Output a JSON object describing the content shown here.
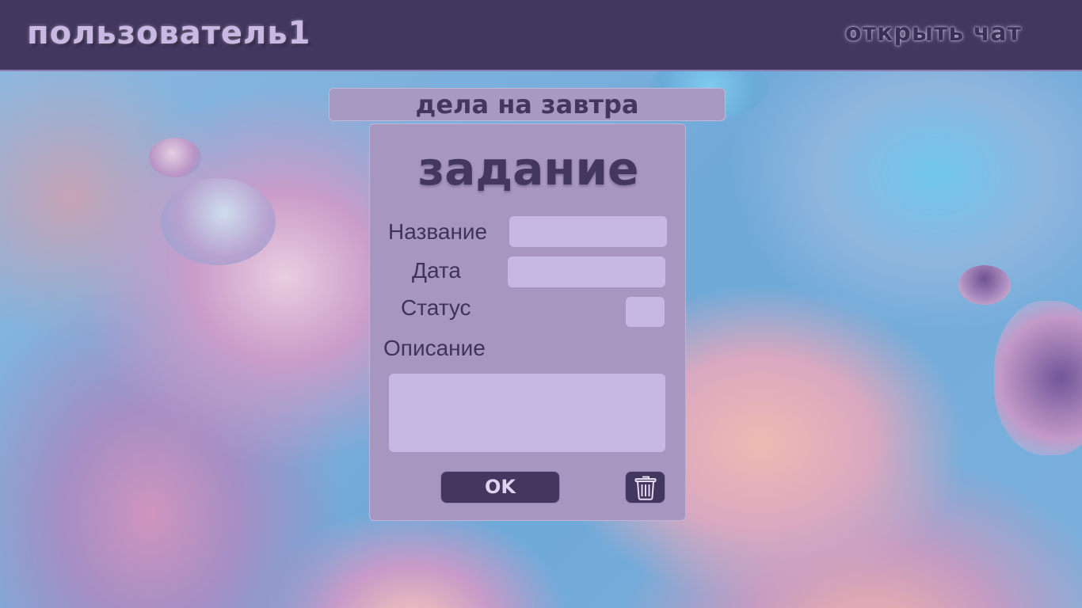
{
  "header": {
    "users_label": "пользователь1",
    "chat_label": "открыть чат"
  },
  "list": {
    "title": "дела на завтра"
  },
  "task": {
    "title": "задание",
    "name_label": "Название",
    "name_value": "",
    "date_label": "Дата",
    "date_value": "",
    "status_label": "Статус",
    "status_value": "",
    "description_label": "Описание",
    "description_value": "",
    "ok_label": "OK",
    "delete_icon": "trash-icon"
  },
  "colors": {
    "topbar": "#42375e",
    "card": "#a797c0",
    "field": "#c7b7e3",
    "button": "#43365f",
    "text_dark": "#43365f",
    "text_light": "#c9b8e3"
  }
}
